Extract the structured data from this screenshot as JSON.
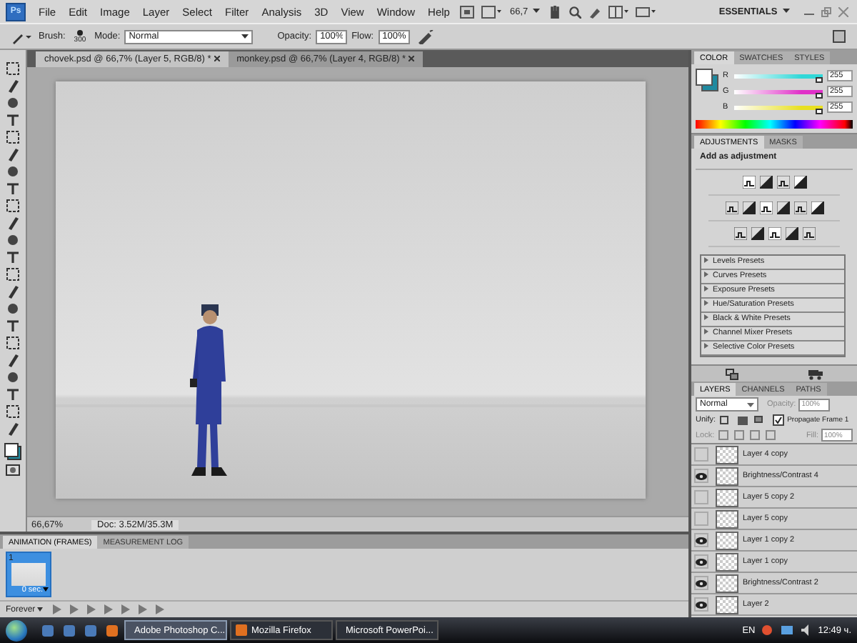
{
  "menu_bar": {
    "logo": "Ps",
    "items": [
      "File",
      "Edit",
      "Image",
      "Layer",
      "Select",
      "Filter",
      "Analysis",
      "3D",
      "View",
      "Window",
      "Help"
    ],
    "zoom": "66,7",
    "workspace": "ESSENTIALS"
  },
  "options_bar": {
    "brush_label": "Brush:",
    "brush_size": "300",
    "mode_label": "Mode:",
    "mode": "Normal",
    "opacity_label": "Opacity:",
    "opacity": "100%",
    "flow_label": "Flow:",
    "flow": "100%"
  },
  "document_tabs": [
    {
      "label": "chovek.psd @ 66,7% (Layer 5, RGB/8) *",
      "selected": true
    },
    {
      "label": "monkey.psd @ 66,7% (Layer 4, RGB/8) *",
      "selected": false
    }
  ],
  "status_bar": {
    "zoom": "66,67%",
    "doc": "Doc: 3.52M/35.3M"
  },
  "color_panel": {
    "tabs": [
      {
        "label": "COLOR",
        "selected": true
      },
      {
        "label": "SWATCHES",
        "selected": false
      },
      {
        "label": "STYLES",
        "selected": false
      }
    ],
    "channels": [
      {
        "name": "R",
        "value": "255",
        "level": 0.97,
        "color": "#30d8d8"
      },
      {
        "name": "G",
        "value": "255",
        "level": 0.97,
        "color": "#e030c8"
      },
      {
        "name": "B",
        "value": "255",
        "level": 0.97,
        "color": "#e8e020"
      }
    ]
  },
  "adjustments_panel": {
    "tabs": [
      {
        "label": "ADJUSTMENTS",
        "selected": true
      },
      {
        "label": "MASKS",
        "selected": false
      }
    ],
    "heading": "Add as adjustment",
    "presets": [
      "Levels Presets",
      "Curves Presets",
      "Exposure Presets",
      "Hue/Saturation Presets",
      "Black & White Presets",
      "Channel Mixer Presets",
      "Selective Color Presets"
    ]
  },
  "layers_panel": {
    "tabs": [
      {
        "label": "LAYERS",
        "selected": true
      },
      {
        "label": "CHANNELS",
        "selected": false
      },
      {
        "label": "PATHS",
        "selected": false
      }
    ],
    "blend_mode": "Normal",
    "opacity_label": "Opacity:",
    "opacity": "100%",
    "unify_label": "Unify:",
    "propagate": {
      "label": "Propagate Frame 1",
      "checked": true
    },
    "lock_label": "Lock:",
    "fill_label": "Fill:",
    "fill": "100%",
    "layers": [
      {
        "name": "Layer 4 copy",
        "visible": false
      },
      {
        "name": "Brightness/Contrast 4",
        "visible": true
      },
      {
        "name": "Layer 5 copy 2",
        "visible": false
      },
      {
        "name": "Layer 5 copy",
        "visible": false
      },
      {
        "name": "Layer 1 copy 2",
        "visible": true
      },
      {
        "name": "Layer 1 copy",
        "visible": true
      },
      {
        "name": "Brightness/Contrast 2",
        "visible": true
      },
      {
        "name": "Layer 2",
        "visible": true
      }
    ]
  },
  "animation_panel": {
    "tabs": [
      {
        "label": "ANIMATION (FRAMES)",
        "selected": true
      },
      {
        "label": "MEASUREMENT LOG",
        "selected": false
      }
    ],
    "frames": [
      {
        "number": "1",
        "delay": "0 sec.",
        "selected": true
      }
    ],
    "loop": "Forever"
  },
  "taskbar": {
    "tasks": [
      {
        "label": "Adobe Photoshop C...",
        "selected": true
      },
      {
        "label": "Mozilla Firefox",
        "selected": false
      },
      {
        "label": "Microsoft PowerPoi...",
        "selected": false
      }
    ],
    "language": "EN",
    "clock": "12:49 ч."
  }
}
